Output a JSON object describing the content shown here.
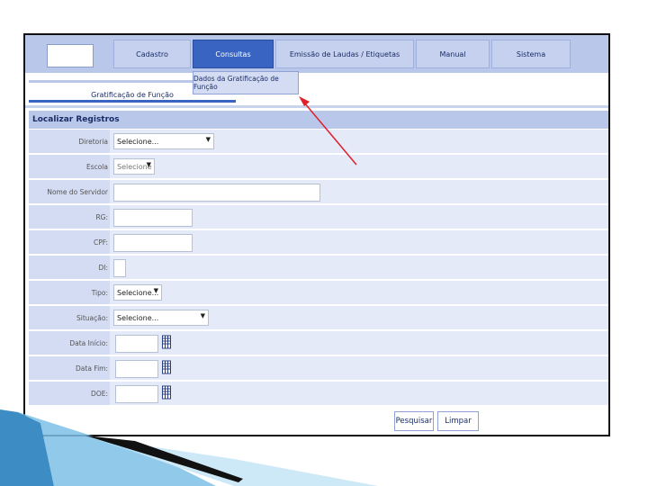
{
  "menu": {
    "items": [
      "Cadastro",
      "Consultas",
      "Emissão de Laudas / Etiquetas",
      "Manual",
      "Sistema"
    ],
    "active": "Consultas",
    "dropdown_item": "Dados da Gratificação de Função"
  },
  "tab": {
    "label": "Gratificação de Função"
  },
  "form": {
    "title": "Localizar Registros",
    "fields": {
      "diretoria": {
        "label": "Diretoria",
        "value": "Selecione..."
      },
      "escola": {
        "label": "Escola",
        "value": "Selecione"
      },
      "nome": {
        "label": "Nome do Servidor",
        "value": ""
      },
      "rg": {
        "label": "RG:",
        "value": ""
      },
      "cpf": {
        "label": "CPF:",
        "value": ""
      },
      "di": {
        "label": "DI:",
        "value": ""
      },
      "tipo": {
        "label": "Tipo:",
        "value": "Selecione..."
      },
      "situacao": {
        "label": "Situação:",
        "value": "Selecione..."
      },
      "data_inicio": {
        "label": "Data Início:",
        "value": ""
      },
      "data_fim": {
        "label": "Data Fim:",
        "value": ""
      },
      "doe": {
        "label": "DOE:",
        "value": ""
      }
    }
  },
  "buttons": {
    "pesquisar": "Pesquisar",
    "limpar": "Limpar"
  },
  "icons": {
    "calendar": "calendar-icon",
    "dropdown": "chevron-down-icon",
    "annotation": "red-arrow-icon"
  },
  "colors": {
    "menu_bg": "#b9c7ea",
    "active": "#3a64c2",
    "row_bg": "#e4eaf8",
    "annotation": "#e0202a"
  }
}
